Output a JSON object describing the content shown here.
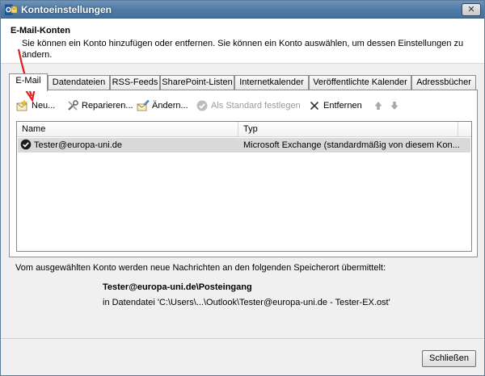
{
  "window": {
    "title": "Kontoeinstellungen",
    "close_label": "✕"
  },
  "header": {
    "title": "E-Mail-Konten",
    "description": "Sie können ein Konto hinzufügen oder entfernen. Sie können ein Konto auswählen, um dessen Einstellungen zu ändern."
  },
  "tabs": [
    {
      "label": "E-Mail"
    },
    {
      "label": "Datendateien"
    },
    {
      "label": "RSS-Feeds"
    },
    {
      "label": "SharePoint-Listen"
    },
    {
      "label": "Internetkalender"
    },
    {
      "label": "Veröffentlichte Kalender"
    },
    {
      "label": "Adressbücher"
    }
  ],
  "toolbar": {
    "new_label": "Neu...",
    "repair_label": "Reparieren...",
    "change_label": "Ändern...",
    "default_label": "Als Standard festlegen",
    "remove_label": "Entfernen"
  },
  "table": {
    "columns": [
      "Name",
      "Typ"
    ],
    "rows": [
      {
        "name": "Tester@europa-uni.de",
        "type": "Microsoft Exchange (standardmäßig von diesem Kon..."
      }
    ]
  },
  "info": {
    "text": "Vom ausgewählten Konto werden neue Nachrichten an den folgenden Speicherort übermittelt:",
    "store_name": "Tester@europa-uni.de\\Posteingang",
    "store_file": "in Datendatei 'C:\\Users\\...\\Outlook\\Tester@europa-uni.de - Tester-EX.ost'"
  },
  "footer": {
    "close_label": "Schließen"
  },
  "colors": {
    "titlebar": "#4e7aa5",
    "selected_row": "#d9d9d9",
    "annotation_arrow": "#e02020"
  }
}
